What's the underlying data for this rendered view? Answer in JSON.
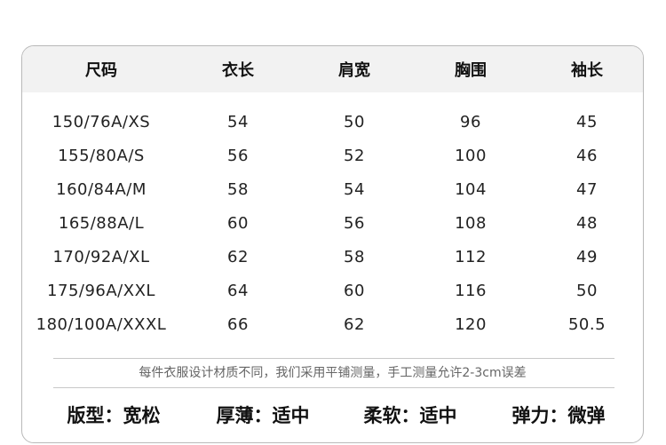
{
  "headers": [
    "尺码",
    "衣长",
    "肩宽",
    "胸围",
    "袖长"
  ],
  "rows": [
    [
      "150/76A/XS",
      "54",
      "50",
      "96",
      "45"
    ],
    [
      "155/80A/S",
      "56",
      "52",
      "100",
      "46"
    ],
    [
      "160/84A/M",
      "58",
      "54",
      "104",
      "47"
    ],
    [
      "165/88A/L",
      "60",
      "56",
      "108",
      "48"
    ],
    [
      "170/92A/XL",
      "62",
      "58",
      "112",
      "49"
    ],
    [
      "175/96A/XXL",
      "64",
      "60",
      "116",
      "50"
    ],
    [
      "180/100A/XXXL",
      "66",
      "62",
      "120",
      "50.5"
    ]
  ],
  "note": "每件衣服设计材质不同，我们采用平铺测量，手工测量允许2-3cm误差",
  "properties": [
    "版型：宽松",
    "厚薄：适中",
    "柔软：适中",
    "弹力：微弹"
  ]
}
